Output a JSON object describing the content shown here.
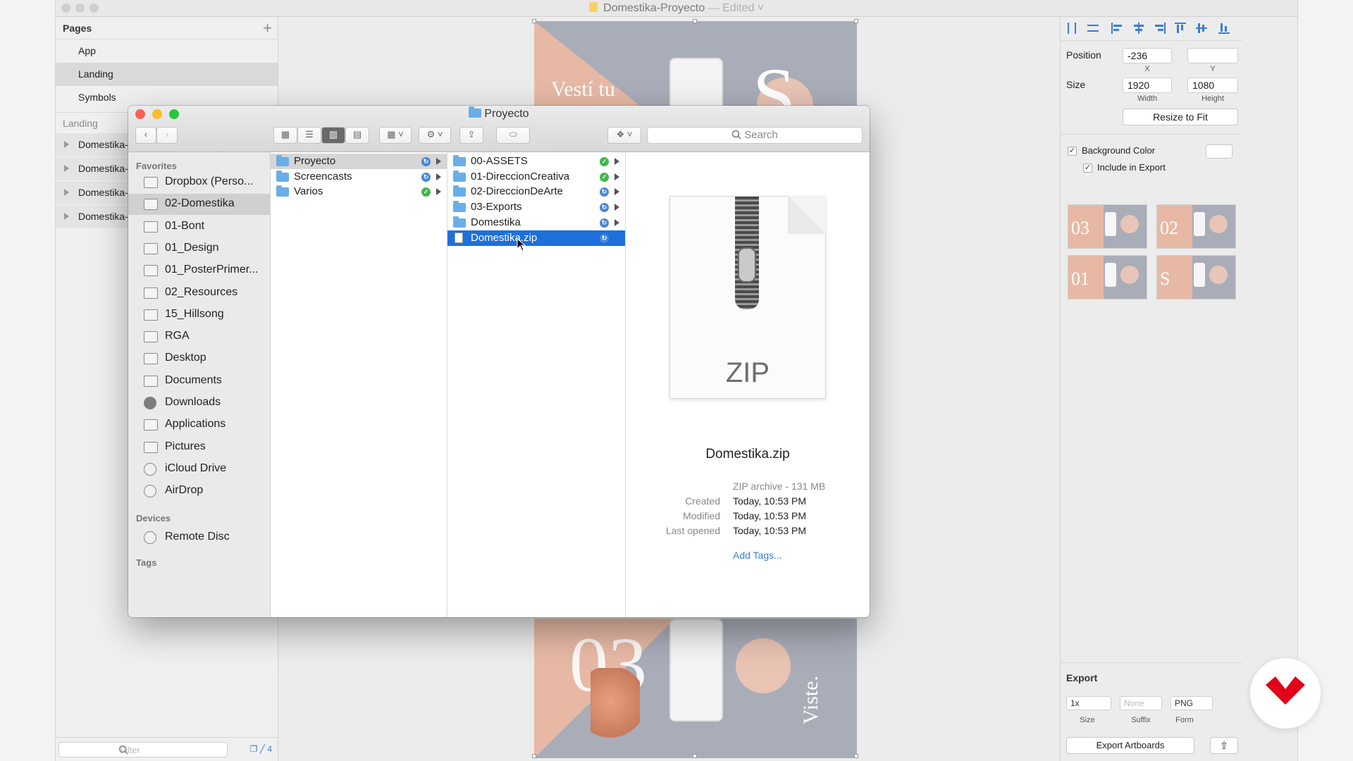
{
  "sketch": {
    "title": "Domestika-Proyecto",
    "edited": "— Edited ˅",
    "pages_header": "Pages",
    "add_page": "+",
    "pages": [
      {
        "label": "App",
        "selected": false
      },
      {
        "label": "Landing",
        "selected": true
      },
      {
        "label": "Symbols",
        "selected": false
      }
    ],
    "layers_header": "Landing",
    "layers": [
      "Domestika-",
      "Domestika-",
      "Domestika-",
      "Domestika-"
    ],
    "filter_placeholder": "Filter",
    "footer_count": "4",
    "artboard_top_text": "Vestí tu",
    "artboard_top_letter": "S",
    "artboard_bottom_number": "03",
    "artboard_bottom_text": "Viste."
  },
  "inspector": {
    "position_label": "Position",
    "x_value": "-236",
    "x_label": "X",
    "y_value": "",
    "y_label": "Y",
    "size_label": "Size",
    "width_value": "1920",
    "width_label": "Width",
    "height_value": "1080",
    "height_label": "Height",
    "resize_button": "Resize to Fit",
    "background_color_label": "Background Color",
    "background_color_checked": true,
    "include_export_label": "Include in Export",
    "include_export_checked": true,
    "thumbnails": [
      "03",
      "02",
      "01",
      "S"
    ],
    "export_header": "Export",
    "export_size_value": "1x",
    "export_suffix_placeholder": "None",
    "export_format_value": "PNG",
    "export_size_label": "Size",
    "export_suffix_label": "Suffix",
    "export_format_label": "Form",
    "export_artboards_button": "Export Artboards"
  },
  "finder": {
    "title": "Proyecto",
    "search_placeholder": "Search",
    "sidebar": {
      "favorites_header": "Favorites",
      "favorites": [
        {
          "label": "Dropbox (Perso...",
          "icon": "dropbox-icon",
          "selected": false
        },
        {
          "label": "02-Domestika",
          "icon": "folder-icon",
          "selected": true
        },
        {
          "label": "01-Bont",
          "icon": "folder-icon",
          "selected": false
        },
        {
          "label": "01_Design",
          "icon": "folder-icon",
          "selected": false
        },
        {
          "label": "01_PosterPrimer...",
          "icon": "folder-icon",
          "selected": false
        },
        {
          "label": "02_Resources",
          "icon": "folder-icon",
          "selected": false
        },
        {
          "label": "15_Hillsong",
          "icon": "folder-icon",
          "selected": false
        },
        {
          "label": "RGA",
          "icon": "folder-icon",
          "selected": false
        },
        {
          "label": "Desktop",
          "icon": "desktop-icon",
          "selected": false
        },
        {
          "label": "Documents",
          "icon": "documents-icon",
          "selected": false
        },
        {
          "label": "Downloads",
          "icon": "downloads-icon",
          "selected": false
        },
        {
          "label": "Applications",
          "icon": "applications-icon",
          "selected": false
        },
        {
          "label": "Pictures",
          "icon": "camera-icon",
          "selected": false
        },
        {
          "label": "iCloud Drive",
          "icon": "cloud-icon",
          "selected": false
        },
        {
          "label": "AirDrop",
          "icon": "airdrop-icon",
          "selected": false
        }
      ],
      "devices_header": "Devices",
      "devices": [
        {
          "label": "Remote Disc",
          "icon": "disc-icon"
        }
      ],
      "tags_header": "Tags"
    },
    "column1": [
      {
        "label": "Proyecto",
        "status": "syncing",
        "selected": true
      },
      {
        "label": "Screencasts",
        "status": "syncing",
        "selected": false
      },
      {
        "label": "Varios",
        "status": "synced",
        "selected": false
      }
    ],
    "column2": [
      {
        "label": "00-ASSETS",
        "status": "synced",
        "folder": true
      },
      {
        "label": "01-DireccionCreativa",
        "status": "synced",
        "folder": true
      },
      {
        "label": "02-DireccionDeArte",
        "status": "syncing",
        "folder": true
      },
      {
        "label": "03-Exports",
        "status": "syncing",
        "folder": true
      },
      {
        "label": "Domestika",
        "status": "syncing",
        "folder": true
      },
      {
        "label": "Domestika.zip",
        "status": "syncing",
        "folder": false,
        "selected": true
      }
    ],
    "preview": {
      "icon_label": "ZIP",
      "name": "Domestika.zip",
      "kind": "ZIP archive - 131 MB",
      "created_label": "Created",
      "created_value": "Today, 10:53 PM",
      "modified_label": "Modified",
      "modified_value": "Today, 10:53 PM",
      "last_opened_label": "Last opened",
      "last_opened_value": "Today, 10:53 PM",
      "add_tags": "Add Tags..."
    }
  },
  "colors": {
    "selection_blue": "#1e6fd9",
    "accent_blue": "#3b7bd4",
    "sync_green": "#3fb849",
    "close_red": "#fc5f57",
    "minimize_yellow": "#fdbc2e",
    "zoom_green": "#29c73f",
    "artboard_gray": "#a9adb8",
    "artboard_peach": "#e7b9a5",
    "logo_red": "#e2001a"
  }
}
